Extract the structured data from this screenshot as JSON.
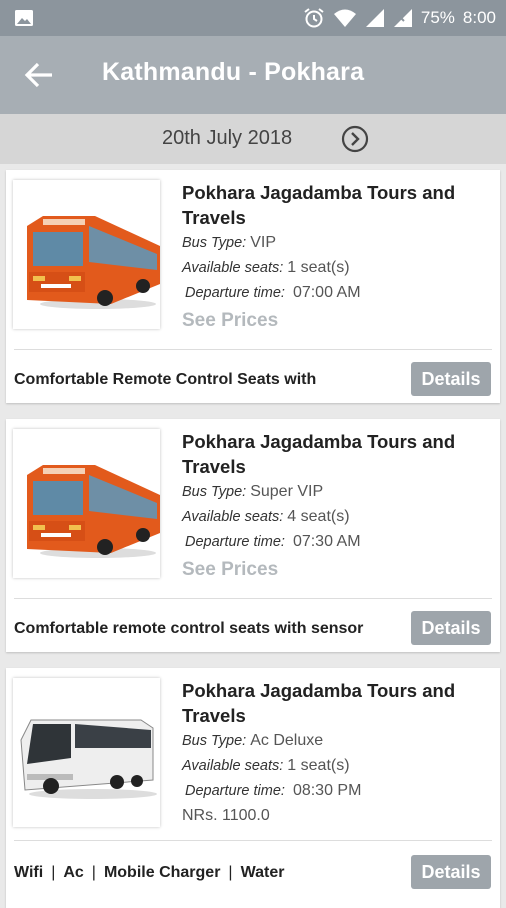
{
  "status_bar": {
    "battery": "75%",
    "time": "8:00"
  },
  "header": {
    "title": "Kathmandu - Pokhara"
  },
  "date_bar": {
    "date": "20th July 2018"
  },
  "labels": {
    "bus_type": "Bus Type:",
    "available_seats": "Available seats:",
    "departure_time": "Departure time:",
    "see_prices": "See Prices",
    "details": "Details"
  },
  "buses": [
    {
      "name": "Pokhara Jagadamba Tours and Travels",
      "bus_type": "VIP",
      "seats": "1 seat(s)",
      "departure": "07:00 AM",
      "description": "Comfortable Remote Control Seats with"
    },
    {
      "name": "Pokhara Jagadamba Tours and Travels",
      "bus_type": "Super VIP",
      "seats": "4 seat(s)",
      "departure": "07:30 AM",
      "description": "Comfortable remote control seats with sensor"
    },
    {
      "name": "Pokhara Jagadamba Tours and Travels",
      "bus_type": "Ac Deluxe",
      "seats": "1 seat(s)",
      "departure": "08:30 PM",
      "price": "NRs. 1100.0",
      "amenities": [
        "Wifi",
        "Ac",
        "Mobile Charger",
        "Water"
      ]
    }
  ]
}
